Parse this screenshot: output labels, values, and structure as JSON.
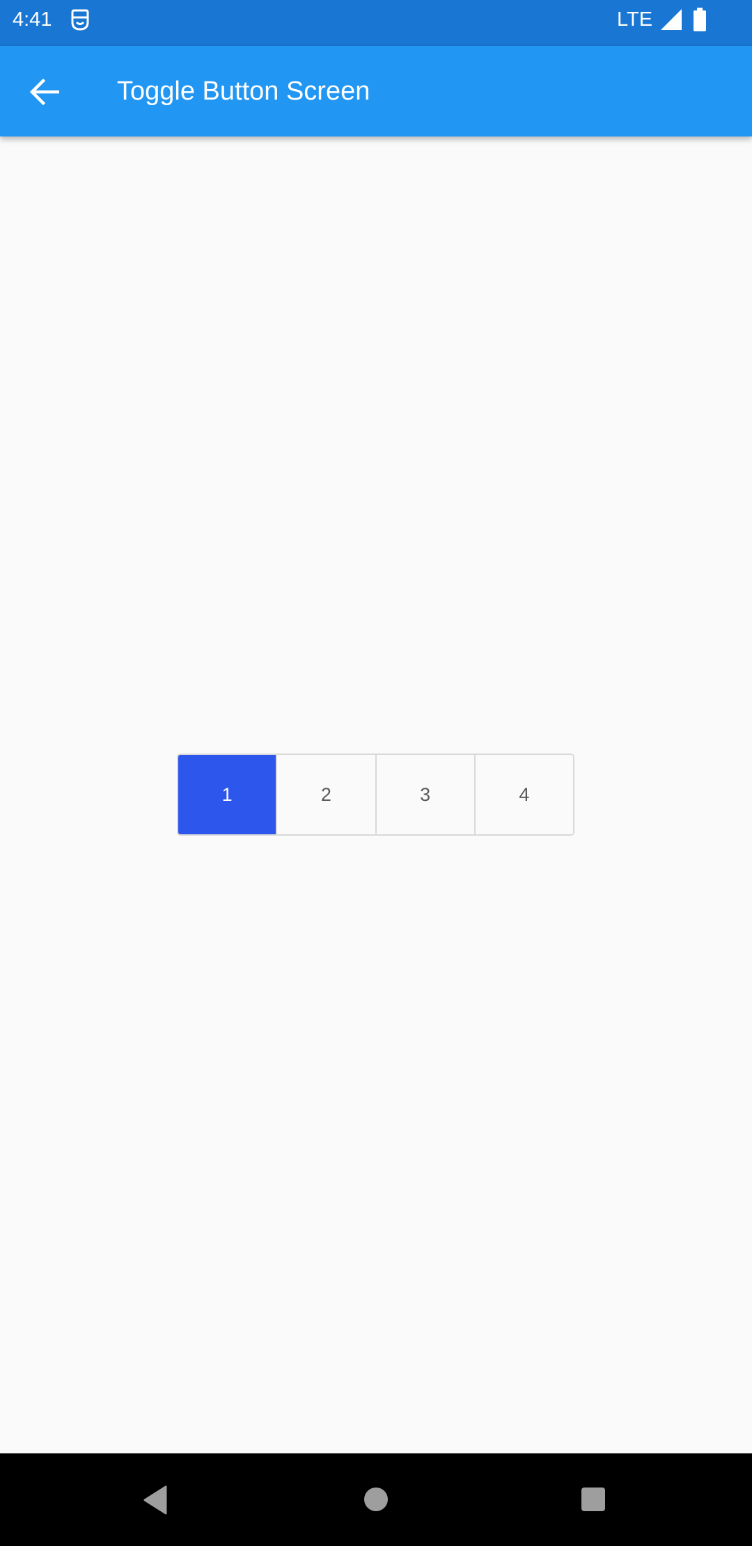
{
  "status_bar": {
    "time": "4:41",
    "network": "LTE",
    "icons": [
      "app-notification-icon",
      "signal-icon",
      "battery-icon"
    ]
  },
  "app_bar": {
    "title": "Toggle Button Screen",
    "back_icon": "arrow-back-icon"
  },
  "toggle_group": {
    "buttons": [
      {
        "label": "1",
        "selected": true
      },
      {
        "label": "2",
        "selected": false
      },
      {
        "label": "3",
        "selected": false
      },
      {
        "label": "4",
        "selected": false
      }
    ]
  },
  "nav_bar": {
    "icons": [
      "nav-back-icon",
      "nav-home-icon",
      "nav-recents-icon"
    ]
  },
  "colors": {
    "status_bar": "#1976d2",
    "app_bar": "#2196f3",
    "selected_toggle": "#2c56ec",
    "background": "#fafafa",
    "nav_bar": "#000000"
  }
}
